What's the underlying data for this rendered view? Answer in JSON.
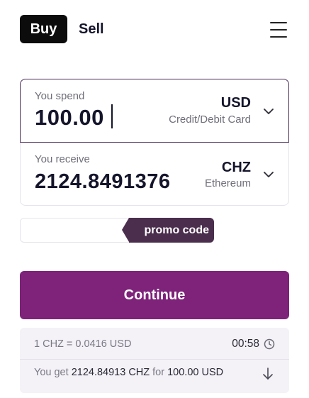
{
  "tabs": {
    "buy": "Buy",
    "sell": "Sell"
  },
  "icons": {
    "menu": "hamburger-menu-icon",
    "chevron": "chevron-down-icon",
    "clock": "clock-icon",
    "arrow": "arrow-down-icon"
  },
  "colors": {
    "primary": "#7e227a",
    "promo": "#4b2e4d",
    "dark": "#0c0c0c",
    "quote_bg": "#f4f1f7"
  },
  "spend": {
    "label": "You spend",
    "value": "100.00",
    "currency": "USD",
    "method": "Credit/Debit Card"
  },
  "receive": {
    "label": "You receive",
    "value": "2124.8491376",
    "currency": "CHZ",
    "network": "Ethereum"
  },
  "promo": {
    "value": "",
    "label": "promo code"
  },
  "continue_label": "Continue",
  "quote": {
    "rate": "1 CHZ = 0.0416 USD",
    "timer": "00:58",
    "get_prefix": "You get",
    "get_amount": "2124.84913 CHZ",
    "get_for": "for",
    "get_price": "100.00 USD"
  }
}
